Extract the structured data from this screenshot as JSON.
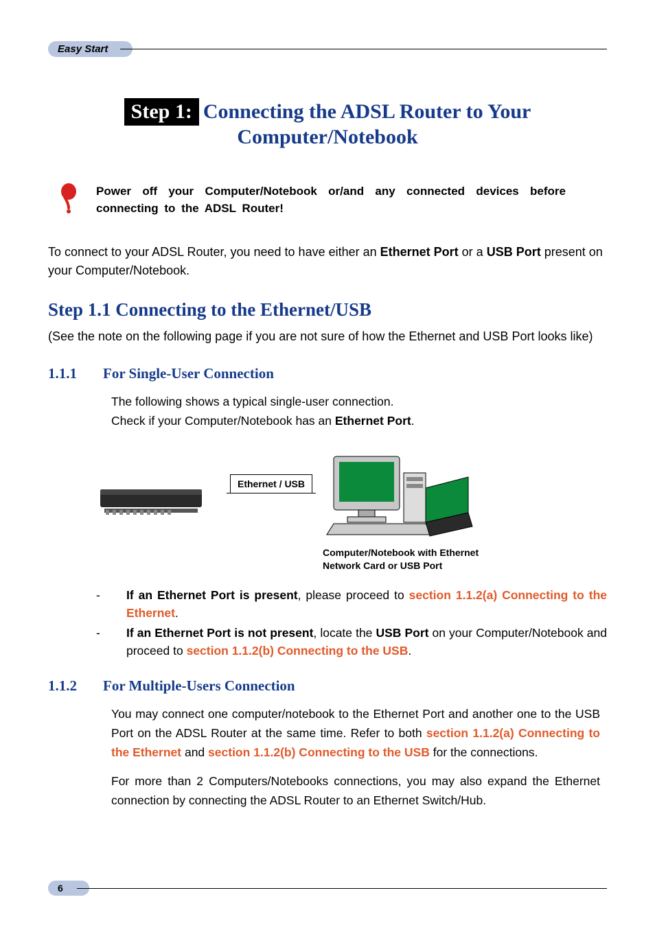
{
  "header": {
    "badge": "Easy Start"
  },
  "step": {
    "badge": "Step 1:",
    "title_line1": "Connecting the ADSL Router to Your",
    "title_line2": "Computer/Notebook"
  },
  "warning": {
    "text": "Power off your Computer/Notebook or/and any connected devices before connecting to the ADSL Router!"
  },
  "intro": {
    "pre": "To connect to your ADSL Router, you need to have either an ",
    "b1": "Ethernet Port",
    "mid": " or a ",
    "b2": "USB Port",
    "post": " present on your Computer/Notebook."
  },
  "sec11": {
    "title": "Step 1.1   Connecting to the Ethernet/USB",
    "note": "(See the note on the following page if you are not sure of how the Ethernet and USB Port looks like)"
  },
  "sec111": {
    "num": "1.1.1",
    "title": "For Single-User Connection",
    "p1": "The following shows a typical single-user connection.",
    "p2a": "Check if your Computer/Notebook has an ",
    "p2b": "Ethernet Port",
    "p2c": "."
  },
  "diagram": {
    "cable_label": "Ethernet / USB",
    "caption": "Computer/Notebook with Ethernet Network Card or USB Port"
  },
  "bullets": {
    "b1_a": "If an Ethernet Port is present",
    "b1_b": ", please proceed to ",
    "b1_link": "section 1.1.2(a) Connecting to the Ethernet",
    "b1_c": ".",
    "b2_a": "If an Ethernet Port is not present",
    "b2_b": ", locate the ",
    "b2_c": "USB Port",
    "b2_d": " on your Computer/Notebook and proceed to ",
    "b2_link": "section 1.1.2(b) Connecting to the USB",
    "b2_e": "."
  },
  "sec112": {
    "num": "1.1.2",
    "title": "For Multiple-Users Connection",
    "p1a": "You may connect one computer/notebook to the Ethernet Port and another one to the USB Port on the ADSL Router at the same time.  Refer to both ",
    "link1": "section 1.1.2(a) Connecting to the Ethernet",
    "p1b": " and ",
    "link2": "section 1.1.2(b) Connecting to the USB",
    "p1c": " for the connections.",
    "p2": "For more than 2 Computers/Notebooks connections, you may also expand the Ethernet connection by connecting the ADSL Router to an Ethernet Switch/Hub."
  },
  "footer": {
    "page": "6"
  }
}
